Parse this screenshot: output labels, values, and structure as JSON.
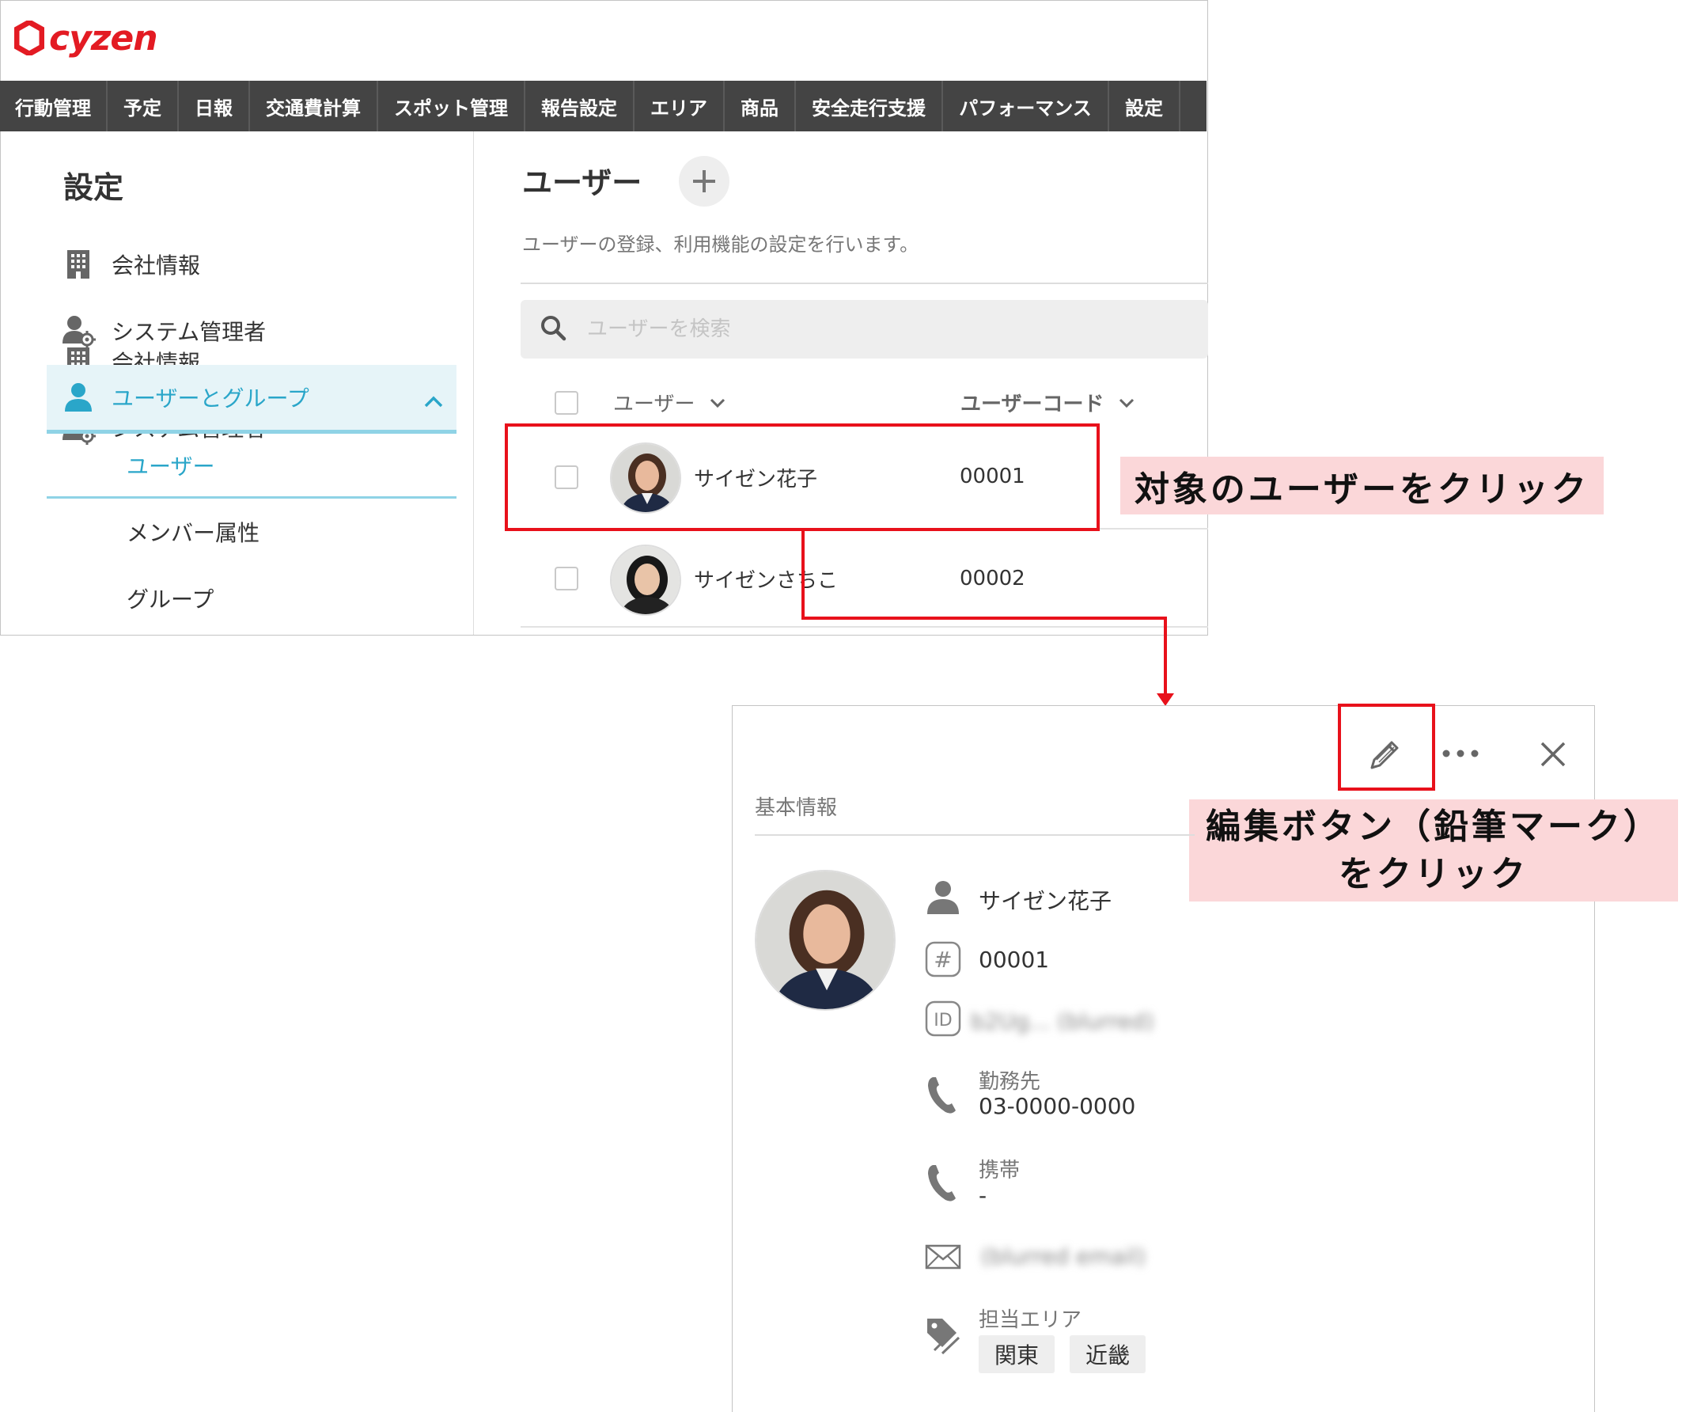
{
  "app": {
    "logo_text": "cyzen",
    "brand_color": "#e31b23",
    "accent_color": "#2aa6c9",
    "annotation_color": "#e8111b"
  },
  "menu": [
    "行動管理",
    "予定",
    "日報",
    "交通費計算",
    "スポット管理",
    "報告設定",
    "エリア",
    "商品",
    "安全走行支援",
    "パフォーマンス",
    "設定"
  ],
  "sidebar": {
    "title": "設定",
    "items": [
      {
        "label": "会社情報",
        "icon": "building-icon"
      },
      {
        "label": "システム管理者",
        "icon": "admin-gear-icon"
      },
      {
        "label": "ユーザーとグループ",
        "icon": "user-icon",
        "expanded": true
      }
    ],
    "sub_items": [
      "ユーザー",
      "メンバー属性",
      "グループ"
    ],
    "active_sub": "ユーザー"
  },
  "main": {
    "title": "ユーザー",
    "description": "ユーザーの登録、利用機能の設定を行います。",
    "search_placeholder": "ユーザーを検索",
    "columns": [
      "ユーザー",
      "ユーザーコード"
    ],
    "rows": [
      {
        "name": "サイゼン花子",
        "code": "00001"
      },
      {
        "name": "サイゼンさちこ",
        "code": "00002"
      }
    ]
  },
  "callouts": {
    "click_user": "対象のユーザーをクリック",
    "edit_line1": "編集ボタン（鉛筆マーク）",
    "edit_line2": "をクリック"
  },
  "detail": {
    "section": "基本情報",
    "name": "サイゼン花子",
    "code": "00001",
    "id_value": "b2Ug... (blurred)",
    "work_label": "勤務先",
    "work_phone": "03-0000-0000",
    "mobile_label": "携帯",
    "mobile_value": "-",
    "email": "(blurred email)",
    "area_label": "担当エリア",
    "areas": [
      "関東",
      "近畿"
    ]
  }
}
